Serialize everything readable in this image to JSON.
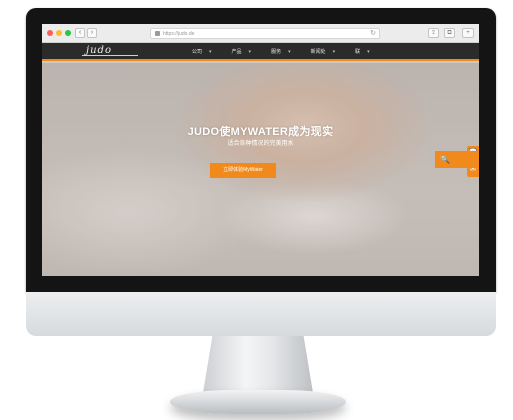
{
  "browser": {
    "url": "https://judo.de",
    "back_icon": "‹",
    "forward_icon": "›",
    "refresh_icon": "↻",
    "share_icon": "⇪",
    "tabs_icon": "⧉",
    "dot_colors": [
      "#ff5f57",
      "#febc2e",
      "#28c840"
    ]
  },
  "site": {
    "logo": "judo",
    "menu": [
      {
        "label": "公司",
        "caret": "▾"
      },
      {
        "label": "产品",
        "caret": "▾"
      },
      {
        "label": "服务",
        "caret": "▾"
      },
      {
        "label": "新闻处",
        "caret": "▾"
      },
      {
        "label": "联",
        "caret": "▾"
      }
    ]
  },
  "hero": {
    "title": "JUDO使MYWATER成为现实",
    "subtitle": "适合各种情况的完美用水",
    "cta_label": "立即体验MyWater"
  },
  "side": {
    "chat_icon": "💬",
    "mail_icon": "✉",
    "search_icon": "🔍"
  },
  "colors": {
    "accent": "#f08a1c",
    "header_bg": "#2b2b2b"
  }
}
